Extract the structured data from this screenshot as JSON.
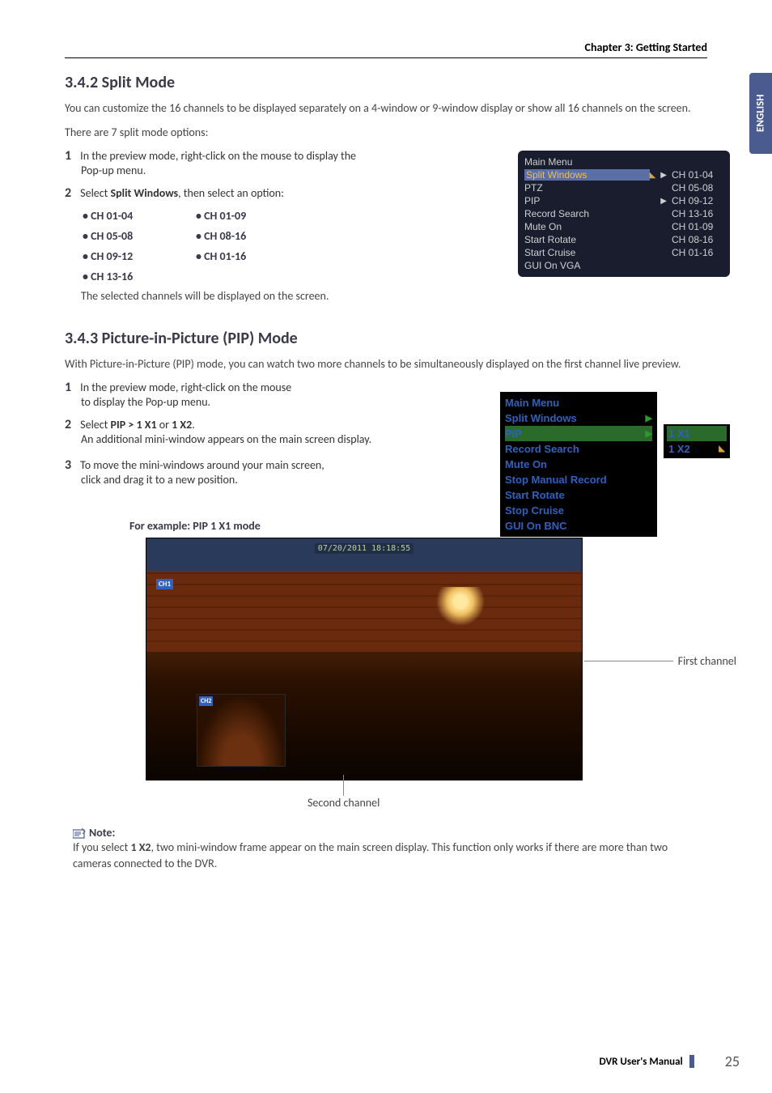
{
  "chapter_header": "Chapter 3: Getting Started",
  "side_tab": "ENGLISH",
  "section1": {
    "heading": "3.4.2 Split Mode",
    "intro": "You can customize the 16 channels to be displayed separately on a 4-window or 9-window display or show all 16 channels on the screen.",
    "subtext": "There are 7 split mode options:",
    "step1_a": "In the preview mode, right-click on the mouse to display the",
    "step1_b": "Pop-up menu.",
    "step2_a": "Select ",
    "step2_bold": "Split Windows",
    "step2_b": ", then select an option:",
    "options_col1": [
      "CH 01-04",
      "CH 05-08",
      "CH 09-12",
      "CH 13-16"
    ],
    "options_col2": [
      "CH 01-09",
      "CH 08-16",
      "CH 01-16"
    ],
    "after": "The selected channels will be displayed on the screen."
  },
  "menu1": {
    "items_left": [
      "Main Menu",
      "Split Windows",
      "PTZ",
      "PIP",
      "Record Search",
      "Mute On",
      "Start Rotate",
      "Start Cruise",
      "GUI On VGA"
    ],
    "highlighted_left_index": 1,
    "items_right": [
      "CH 01-04",
      "CH 05-08",
      "CH 09-12",
      "CH 13-16",
      "CH 01-09",
      "CH 08-16",
      "CH 01-16"
    ],
    "arrows_at": [
      1,
      3
    ]
  },
  "section2": {
    "heading": "3.4.3 Picture-in-Picture (PIP) Mode",
    "intro": "With Picture-in-Picture (PIP) mode, you can watch two more channels to be simultaneously displayed on the first channel live preview.",
    "step1_a": "In the preview mode, right-click on the mouse",
    "step1_b": "to display the Pop-up menu.",
    "step2_a": "Select ",
    "step2_bold1": "PIP > 1 X1",
    "step2_mid": " or ",
    "step2_bold2": "1 X2",
    "step2_end": ".",
    "step2_after": "An additional mini-window appears on the main screen display.",
    "step3_a": "To move the mini-windows around your main screen,",
    "step3_b": "click and drag it to a new position."
  },
  "menu2": {
    "items": [
      "Main Menu",
      "Split Windows",
      "PIP",
      "Record Search",
      "Mute On",
      "Stop Manual Record",
      "Start Rotate",
      "Stop Cruise",
      "GUI On BNC"
    ],
    "highlighted_index": 2,
    "sub_items": [
      "1 X1",
      "1 X2"
    ],
    "sub_highlighted_index": 0
  },
  "pip_example": {
    "caption": "For example: PIP 1 X1 mode",
    "timestamp": "07/20/2011 18:18:55",
    "ch1_label": "CH1",
    "ch2_label": "CH2",
    "callout_first": "First channel",
    "callout_second": "Second channel"
  },
  "note": {
    "label": "Note:",
    "text_a": "If you select ",
    "bold": "1 X2",
    "text_b": ", two mini-window frame appear on the main screen display. This function only works if there are more than two cameras connected to the DVR."
  },
  "footer": {
    "manual": "DVR User's Manual",
    "page": "25"
  }
}
